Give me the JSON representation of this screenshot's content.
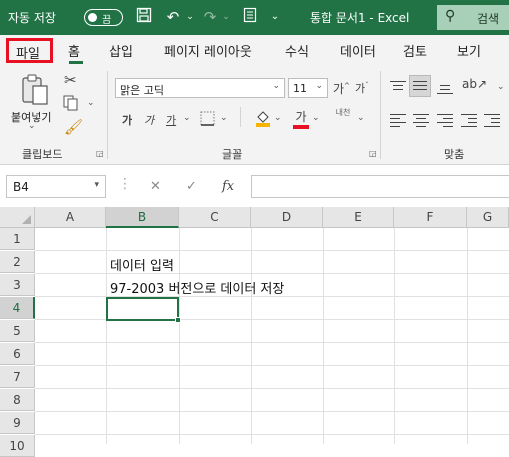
{
  "titlebar": {
    "autosave_label": "자동 저장",
    "toggle_label": "끔",
    "doc_title": "통합 문서1  -  Excel",
    "search_label": "검색"
  },
  "tabs": [
    "홈",
    "삽입",
    "페이지 레이아웃",
    "수식",
    "데이터",
    "검토",
    "보기"
  ],
  "file_tab": "파일",
  "ribbon": {
    "clipboard": {
      "paste_label": "붙여넣기",
      "group_label": "클립보드"
    },
    "font": {
      "font_name": "맑은 고딕",
      "font_size": "11",
      "group_label": "글꼴",
      "grow": "가ˆ",
      "shrink": "가ˇ",
      "bold": "가",
      "italic": "가",
      "underline": "가",
      "font_color": "가",
      "phonetic": "내천"
    },
    "alignment": {
      "group_label": "맞춤"
    }
  },
  "formula_bar": {
    "name_box": "B4",
    "fx": "fx",
    "formula": ""
  },
  "sheet": {
    "columns": [
      "A",
      "B",
      "C",
      "D",
      "E",
      "F",
      "G"
    ],
    "rows": [
      "1",
      "2",
      "3",
      "4",
      "5",
      "6",
      "7",
      "8",
      "9",
      "10"
    ],
    "active_cell": "B4",
    "cells": {
      "B2": "데이터 입력",
      "B3": "97-2003 버전으로 데이터 저장"
    }
  },
  "colors": {
    "accent": "#217346",
    "highlight_box": "#e81123",
    "font_color": "#e81123",
    "fill_color": "#f4b400"
  }
}
